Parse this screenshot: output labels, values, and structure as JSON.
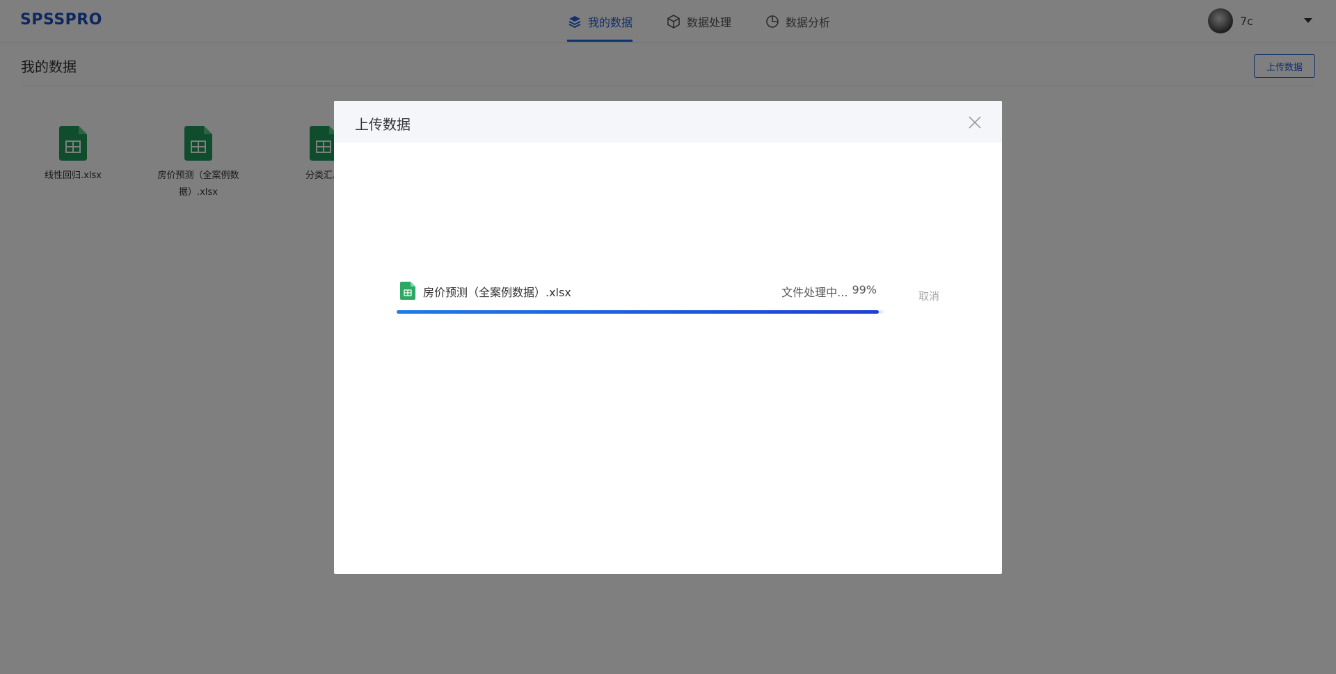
{
  "header": {
    "logo": "SPSSPRO",
    "nav": [
      {
        "label": "我的数据",
        "icon": "layers-icon",
        "active": true
      },
      {
        "label": "数据处理",
        "icon": "cube-icon",
        "active": false
      },
      {
        "label": "数据分析",
        "icon": "pie-chart-icon",
        "active": false
      }
    ],
    "user": {
      "name": "7c"
    }
  },
  "page": {
    "title": "我的数据",
    "upload_button": "上传数据"
  },
  "files": [
    {
      "name": "线性回归.xlsx"
    },
    {
      "name": "房价预测（全案例数据）.xlsx"
    },
    {
      "name": "分类汇总"
    }
  ],
  "modal": {
    "title": "上传数据",
    "upload": {
      "file_name": "房价预测（全案例数据）.xlsx",
      "status_text": "文件处理中...",
      "percent_text": "99%",
      "progress": 0.99,
      "cancel_label": "取消"
    }
  },
  "colors": {
    "accent": "#2260d8",
    "file_icon": "#1e9b5a",
    "overlay": "rgba(0,0,0,0.5)"
  }
}
